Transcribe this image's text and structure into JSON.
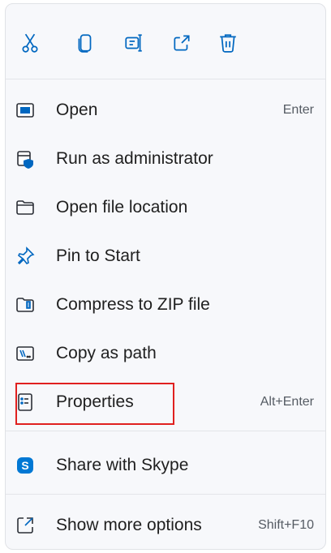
{
  "toolbar": {
    "buttons": [
      {
        "name": "cut",
        "icon": "scissors-icon"
      },
      {
        "name": "copy",
        "icon": "copy-icon"
      },
      {
        "name": "rename",
        "icon": "rename-icon"
      },
      {
        "name": "share",
        "icon": "share-icon"
      },
      {
        "name": "delete",
        "icon": "trash-icon"
      }
    ]
  },
  "menu": {
    "items": [
      {
        "label": "Open",
        "shortcut": "Enter",
        "icon": "open-app-icon"
      },
      {
        "label": "Run as administrator",
        "shortcut": "",
        "icon": "admin-shield-icon"
      },
      {
        "label": "Open file location",
        "shortcut": "",
        "icon": "folder-icon"
      },
      {
        "label": "Pin to Start",
        "shortcut": "",
        "icon": "pin-icon"
      },
      {
        "label": "Compress to ZIP file",
        "shortcut": "",
        "icon": "zip-folder-icon"
      },
      {
        "label": "Copy as path",
        "shortcut": "",
        "icon": "copy-path-icon"
      },
      {
        "label": "Properties",
        "shortcut": "Alt+Enter",
        "icon": "properties-icon"
      },
      {
        "label": "Share with Skype",
        "shortcut": "",
        "icon": "skype-icon"
      },
      {
        "label": "Show more options",
        "shortcut": "Shift+F10",
        "icon": "more-options-icon"
      }
    ]
  },
  "colors": {
    "accent": "#0067c0",
    "highlight_border": "#e0201f",
    "menu_bg": "#f7f8fb"
  }
}
